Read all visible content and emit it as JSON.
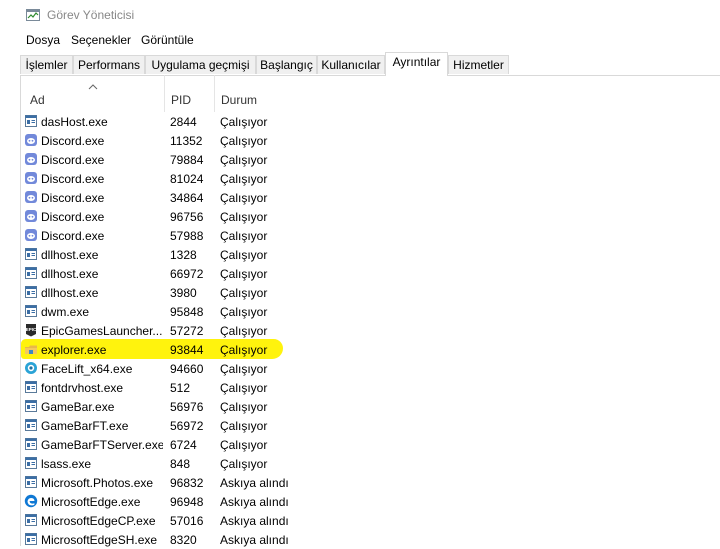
{
  "window": {
    "title": "Görev Yöneticisi"
  },
  "menu": [
    {
      "label": "Dosya"
    },
    {
      "label": "Seçenekler"
    },
    {
      "label": "Görüntüle"
    }
  ],
  "tabs": [
    {
      "label": "İşlemler"
    },
    {
      "label": "Performans"
    },
    {
      "label": "Uygulama geçmişi"
    },
    {
      "label": "Başlangıç"
    },
    {
      "label": "Kullanıcılar"
    },
    {
      "label": "Ayrıntılar",
      "active": true
    },
    {
      "label": "Hizmetler"
    }
  ],
  "columns": {
    "name": "Ad",
    "pid": "PID",
    "status": "Durum"
  },
  "highlight_color": "#fff200",
  "rows": [
    {
      "name": "dasHost.exe",
      "pid": "2844",
      "status": "Çalışıyor",
      "icon": "generic-exe-icon"
    },
    {
      "name": "Discord.exe",
      "pid": "11352",
      "status": "Çalışıyor",
      "icon": "discord-icon"
    },
    {
      "name": "Discord.exe",
      "pid": "79884",
      "status": "Çalışıyor",
      "icon": "discord-icon"
    },
    {
      "name": "Discord.exe",
      "pid": "81024",
      "status": "Çalışıyor",
      "icon": "discord-icon"
    },
    {
      "name": "Discord.exe",
      "pid": "34864",
      "status": "Çalışıyor",
      "icon": "discord-icon"
    },
    {
      "name": "Discord.exe",
      "pid": "96756",
      "status": "Çalışıyor",
      "icon": "discord-icon"
    },
    {
      "name": "Discord.exe",
      "pid": "57988",
      "status": "Çalışıyor",
      "icon": "discord-icon"
    },
    {
      "name": "dllhost.exe",
      "pid": "1328",
      "status": "Çalışıyor",
      "icon": "generic-exe-icon"
    },
    {
      "name": "dllhost.exe",
      "pid": "66972",
      "status": "Çalışıyor",
      "icon": "generic-exe-icon"
    },
    {
      "name": "dllhost.exe",
      "pid": "3980",
      "status": "Çalışıyor",
      "icon": "generic-exe-icon"
    },
    {
      "name": "dwm.exe",
      "pid": "95848",
      "status": "Çalışıyor",
      "icon": "generic-exe-icon"
    },
    {
      "name": "EpicGamesLauncher....",
      "pid": "57272",
      "status": "Çalışıyor",
      "icon": "epic-games-icon"
    },
    {
      "name": "explorer.exe",
      "pid": "93844",
      "status": "Çalışıyor",
      "icon": "explorer-icon",
      "highlighted": true
    },
    {
      "name": "FaceLift_x64.exe",
      "pid": "94660",
      "status": "Çalışıyor",
      "icon": "facelift-icon"
    },
    {
      "name": "fontdrvhost.exe",
      "pid": "512",
      "status": "Çalışıyor",
      "icon": "generic-exe-icon"
    },
    {
      "name": "GameBar.exe",
      "pid": "56976",
      "status": "Çalışıyor",
      "icon": "generic-exe-icon"
    },
    {
      "name": "GameBarFT.exe",
      "pid": "56972",
      "status": "Çalışıyor",
      "icon": "generic-exe-icon"
    },
    {
      "name": "GameBarFTServer.exe",
      "pid": "6724",
      "status": "Çalışıyor",
      "icon": "generic-exe-icon"
    },
    {
      "name": "lsass.exe",
      "pid": "848",
      "status": "Çalışıyor",
      "icon": "generic-exe-icon"
    },
    {
      "name": "Microsoft.Photos.exe",
      "pid": "96832",
      "status": "Askıya alındı",
      "icon": "generic-exe-icon"
    },
    {
      "name": "MicrosoftEdge.exe",
      "pid": "96948",
      "status": "Askıya alındı",
      "icon": "edge-icon"
    },
    {
      "name": "MicrosoftEdgeCP.exe",
      "pid": "57016",
      "status": "Askıya alındı",
      "icon": "generic-exe-icon"
    },
    {
      "name": "MicrosoftEdgeSH.exe",
      "pid": "8320",
      "status": "Askıya alındı",
      "icon": "generic-exe-icon"
    }
  ]
}
